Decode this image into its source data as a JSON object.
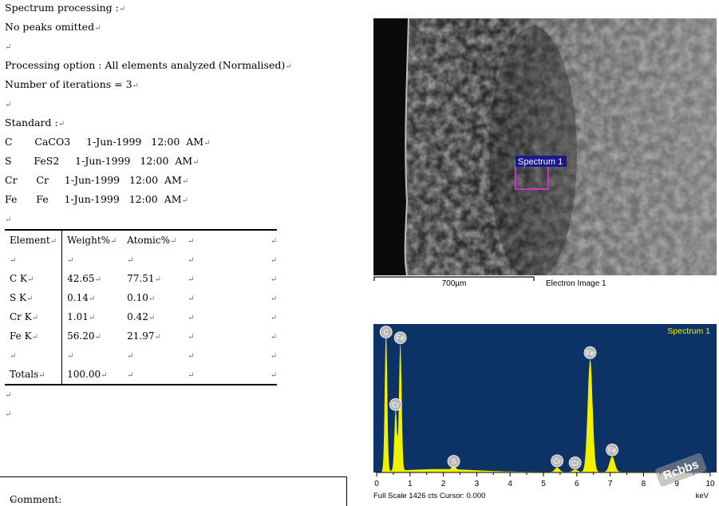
{
  "colors": {
    "spectrum_bg": "#0d3266",
    "spectrum_peak": "#f2f200",
    "marker": "#cc33cc",
    "label_bg": "#1a1a8c"
  },
  "text_lines": [
    "Spectrum processing :",
    "No peaks omitted",
    "",
    "Processing option : All elements analyzed (Normalised)",
    "Number of iterations = 3",
    "",
    "Standard :",
    "C       CaCO3     1-Jun-1999   12:00  AM",
    "S       FeS2     1-Jun-1999   12:00  AM",
    "Cr      Cr     1-Jun-1999   12:00  AM",
    "Fe      Fe     1-Jun-1999   12:00  AM",
    ""
  ],
  "paragraph_mark": "↵",
  "table": {
    "headers": [
      "Element",
      "Weight%",
      "Atomic%"
    ],
    "rows": [
      [
        "",
        "",
        ""
      ],
      [
        "C K",
        "42.65",
        "77.51"
      ],
      [
        "S K",
        "0.14",
        "0.10"
      ],
      [
        "Cr K",
        "1.01",
        "0.42"
      ],
      [
        "Fe K",
        "56.20",
        "21.97"
      ],
      [
        "",
        "",
        ""
      ],
      [
        "Totals",
        "100.00",
        ""
      ]
    ]
  },
  "after_table_lines": [
    "",
    ""
  ],
  "comment_label": "Comment:",
  "sem": {
    "spectrum_label": "Spectrum 1",
    "scale_label": "700µm",
    "caption": "Electron Image 1"
  },
  "chart_data": {
    "type": "line",
    "title": "Spectrum 1",
    "xlabel": "keV",
    "xlim": [
      0,
      10
    ],
    "x_ticks": [
      "0",
      "1",
      "2",
      "3",
      "4",
      "5",
      "6",
      "7",
      "8",
      "9",
      "10"
    ],
    "footer": "Full Scale 1426 cts Cursor: 0.000",
    "full_scale_cts": 1426,
    "peaks": [
      {
        "label": "C",
        "kev": 0.28,
        "counts": 1426
      },
      {
        "label": "Cr",
        "kev": 0.57,
        "counts": 610
      },
      {
        "label": "Fe",
        "kev": 0.71,
        "counts": 1280
      },
      {
        "label": "S",
        "kev": 2.31,
        "counts": 40
      },
      {
        "label": "Cr",
        "kev": 5.41,
        "counts": 45
      },
      {
        "label": "Cr",
        "kev": 5.95,
        "counts": 25
      },
      {
        "label": "Fe",
        "kev": 6.4,
        "counts": 1130
      },
      {
        "label": "Fe",
        "kev": 7.06,
        "counts": 155
      }
    ]
  },
  "watermark": "Rcbbs"
}
